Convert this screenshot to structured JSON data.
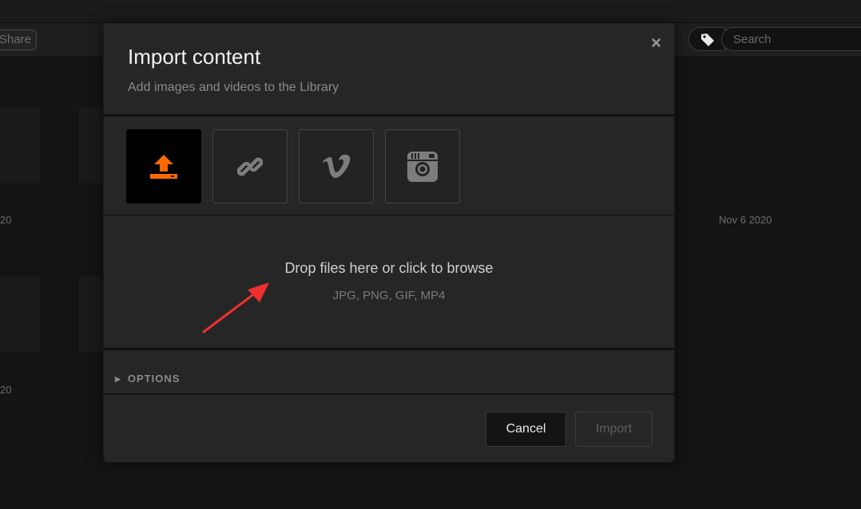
{
  "background": {
    "share_label": "Share",
    "search_placeholder": "Search",
    "date_labels": [
      "20",
      "Nov 6 2020",
      "20"
    ]
  },
  "modal": {
    "title": "Import content",
    "subtitle": "Add images and videos to the Library",
    "close_glyph": "×",
    "sources": [
      {
        "id": "upload",
        "icon": "upload-icon",
        "active": true
      },
      {
        "id": "link",
        "icon": "link-icon",
        "active": false
      },
      {
        "id": "vimeo",
        "icon": "vimeo-icon",
        "active": false
      },
      {
        "id": "instagram",
        "icon": "instagram-icon",
        "active": false
      }
    ],
    "dropzone": {
      "text": "Drop files here or click to browse",
      "formats": "JPG, PNG, GIF, MP4"
    },
    "options_label": "OPTIONS",
    "cancel_label": "Cancel",
    "import_label": "Import"
  },
  "colors": {
    "accent": "#ff6a00",
    "annotation_arrow": "#f03030"
  }
}
